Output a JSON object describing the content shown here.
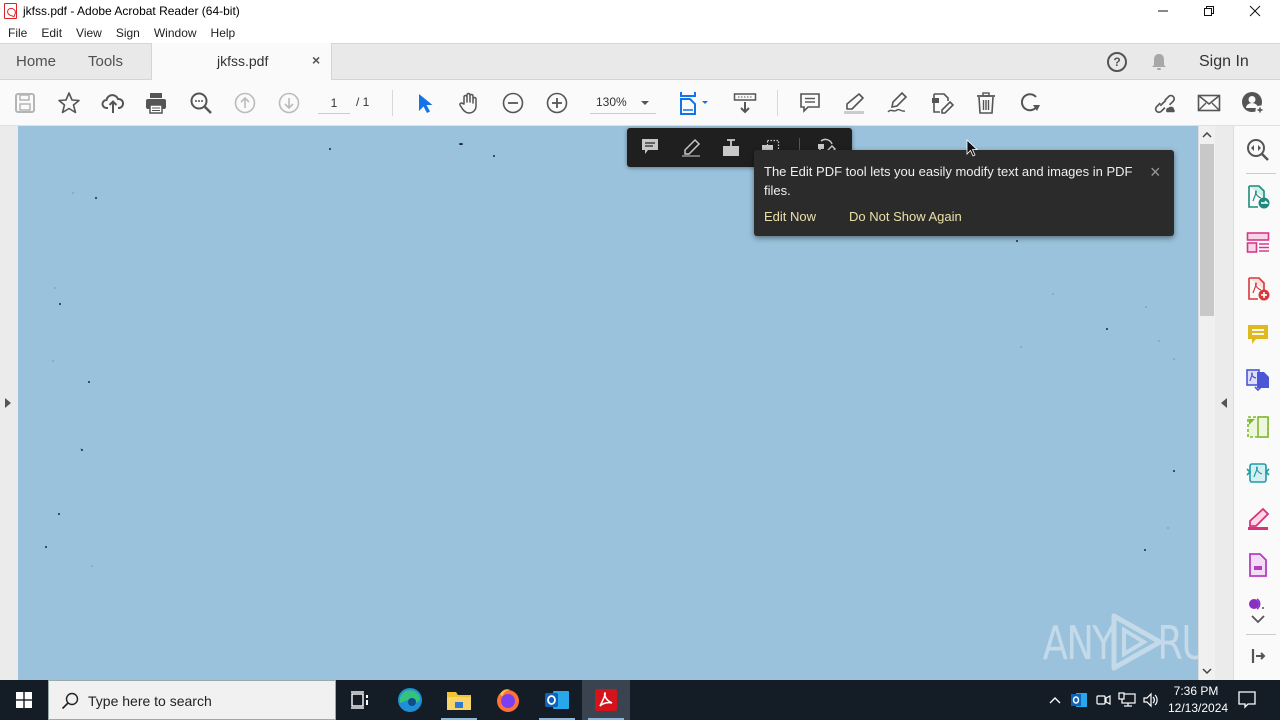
{
  "window": {
    "title": "jkfss.pdf - Adobe Acrobat Reader (64-bit)",
    "controls": {
      "minimize": "minimize-icon",
      "restore": "restore-icon",
      "close": "close-icon"
    }
  },
  "menu": {
    "items": [
      {
        "label": "File"
      },
      {
        "label": "Edit"
      },
      {
        "label": "View"
      },
      {
        "label": "Sign"
      },
      {
        "label": "Window"
      },
      {
        "label": "Help"
      }
    ]
  },
  "tabs": {
    "home": "Home",
    "tools": "Tools",
    "document": "jkfss.pdf",
    "close_glyph": "×"
  },
  "header_right": {
    "help_glyph": "?",
    "sign_in": "Sign In"
  },
  "toolbar": {
    "page_current": "1",
    "page_total": "/ 1",
    "zoom_level": "130%",
    "left_icons": [
      "save-icon",
      "bookmark-star-icon",
      "cloud-upload-icon",
      "print-icon",
      "find-text-icon",
      "previous-page-icon",
      "next-page-icon"
    ],
    "center_icons": [
      "select-cursor-icon",
      "hand-tool-icon",
      "zoom-out-icon",
      "zoom-in-icon",
      "page-fit-icon",
      "scroll-mode-icon"
    ],
    "annotate_icons": [
      "comment-icon",
      "highlight-icon",
      "sign-icon",
      "edit-pdf-icon",
      "delete-icon",
      "rotate-icon"
    ],
    "right_icons": [
      "share-link-icon",
      "email-icon",
      "add-user-icon"
    ]
  },
  "quick_tools": {
    "icons": [
      "sticky-note-icon",
      "highlight-icon",
      "text-box-icon",
      "snapshot-icon",
      "edit-pdf-icon"
    ]
  },
  "edit_tip": {
    "message": "The Edit PDF tool lets you easily modify text and images in PDF files.",
    "primary_action": "Edit Now",
    "secondary_action": "Do Not Show Again",
    "close_glyph": "×"
  },
  "scrollbar": {
    "up_glyph": "^",
    "down_glyph": "v",
    "position_fraction": 0.0
  },
  "right_pane": {
    "tools": [
      {
        "name": "search-tools-icon",
        "color": "#555555"
      },
      {
        "name": "export-pdf-icon",
        "color": "#1f8a7c"
      },
      {
        "name": "organize-pages-icon",
        "color": "#d43a8c"
      },
      {
        "name": "create-pdf-icon",
        "color": "#d8383a"
      },
      {
        "name": "comment-tool-icon",
        "color": "#e0b81f"
      },
      {
        "name": "combine-files-icon",
        "color": "#4b55d6"
      },
      {
        "name": "compress-pdf-icon",
        "color": "#7fba2e"
      },
      {
        "name": "scan-ocr-icon",
        "color": "#1e9ca8"
      },
      {
        "name": "fill-sign-icon",
        "color": "#d8327a"
      },
      {
        "name": "protect-pdf-icon",
        "color": "#b83cc2"
      },
      {
        "name": "more-tools-icon",
        "color": "#8a2fc4"
      }
    ]
  },
  "watermark": {
    "left": "ANY",
    "right": "RUN"
  },
  "taskbar": {
    "search_placeholder": "Type here to search",
    "apps": [
      "task-view-icon",
      "edge-icon",
      "file-explorer-icon",
      "firefox-icon",
      "outlook-icon",
      "acrobat-icon"
    ],
    "tray": [
      "show-hidden-icons-icon",
      "outlook-tray-icon",
      "camera-icon",
      "network-icon",
      "volume-icon"
    ],
    "time": "7:36 PM",
    "date": "12/13/2024"
  },
  "colors": {
    "document_bg": "#9bc2dc",
    "accent_blue": "#1473e6",
    "tip_link": "#e9e0a8",
    "taskbar_bg": "#141c26"
  }
}
